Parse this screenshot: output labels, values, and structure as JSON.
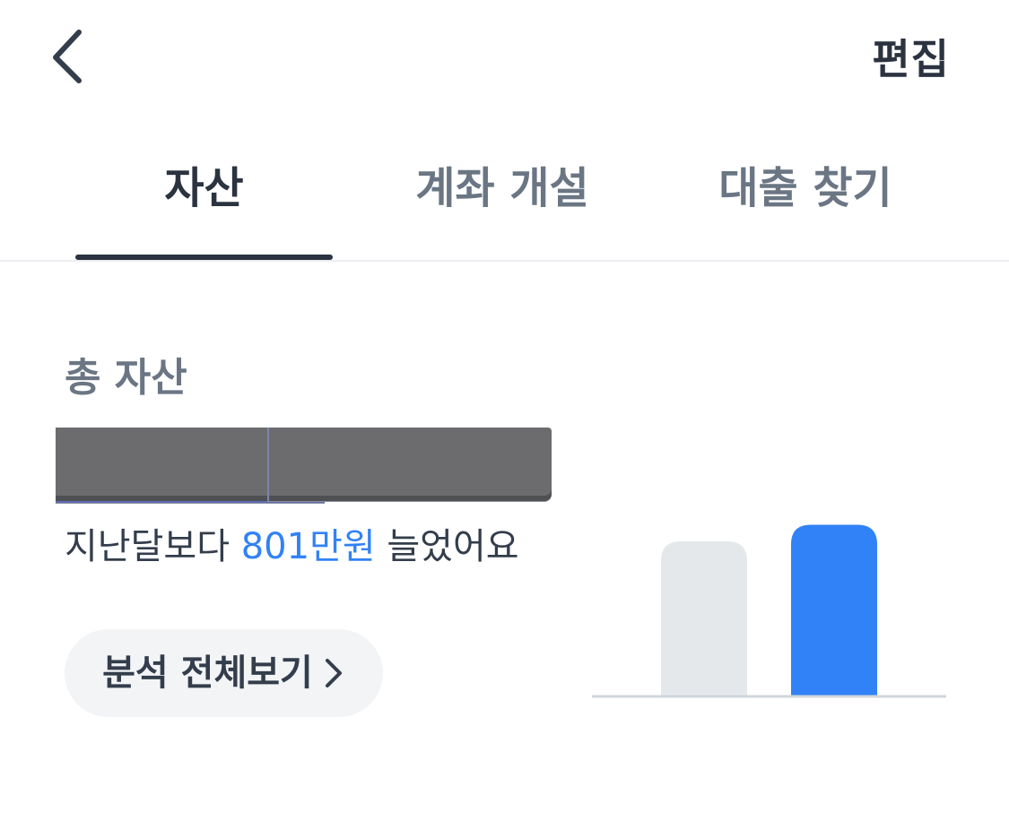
{
  "header": {
    "back_icon": "chevron-left-icon",
    "edit_label": "편집"
  },
  "tabs": [
    {
      "label": "자산",
      "active": true
    },
    {
      "label": "계좌 개설",
      "active": false
    },
    {
      "label": "대출 찾기",
      "active": false
    }
  ],
  "summary": {
    "total_label": "총 자산",
    "change_prefix": "지난달보다 ",
    "change_amount": "801만원",
    "change_suffix": " 늘었어요",
    "analysis_button_label": "분석 전체보기",
    "analysis_icon": "chevron-right-icon"
  },
  "colors": {
    "primary_text": "#2b3340",
    "secondary_text": "#6b7684",
    "accent_blue": "#3182f6",
    "bar_gray": "#e5e8eb",
    "button_bg": "#f2f4f6"
  },
  "chart_data": {
    "type": "bar",
    "categories": [
      "",
      ""
    ],
    "values": [
      167,
      185
    ],
    "colors": [
      "#e5e8eb",
      "#3182f6"
    ],
    "title": "",
    "xlabel": "",
    "ylabel": "",
    "ylim": [
      0,
      200
    ],
    "grid": false
  }
}
